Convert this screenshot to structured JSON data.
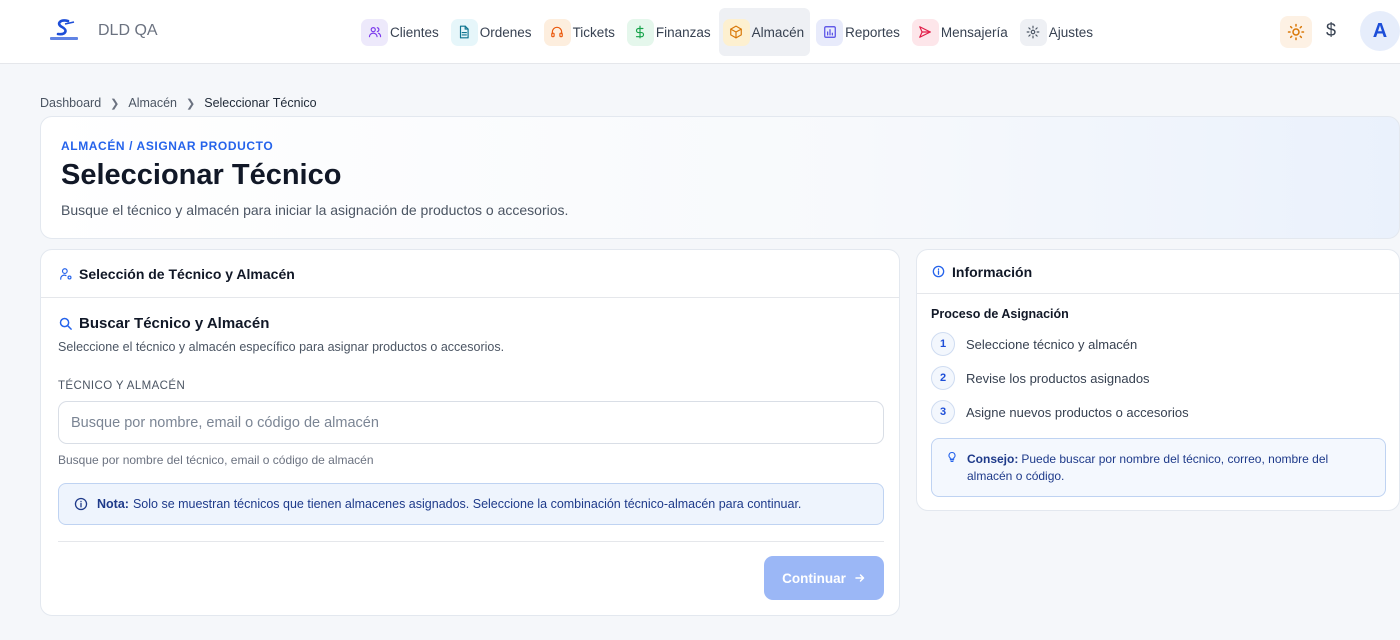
{
  "app": {
    "title": "DLD QA"
  },
  "nav": [
    {
      "label": "Clientes",
      "icon": "users-icon",
      "bg": "#ede9fb",
      "fg": "#7c3aed",
      "active": false
    },
    {
      "label": "Ordenes",
      "icon": "document-icon",
      "bg": "#e6f6fa",
      "fg": "#0e7490",
      "active": false
    },
    {
      "label": "Tickets",
      "icon": "headset-icon",
      "bg": "#fdeede",
      "fg": "#ea580c",
      "active": false
    },
    {
      "label": "Finanzas",
      "icon": "dollar-icon",
      "bg": "#e5f7ec",
      "fg": "#16a34a",
      "active": false
    },
    {
      "label": "Almacén",
      "icon": "box-icon",
      "bg": "#fdf0d0",
      "fg": "#d97706",
      "active": true
    },
    {
      "label": "Reportes",
      "icon": "chart-icon",
      "bg": "#e8ebfb",
      "fg": "#4f46e5",
      "active": false
    },
    {
      "label": "Mensajería",
      "icon": "send-icon",
      "bg": "#fde6ea",
      "fg": "#e11d48",
      "active": false
    },
    {
      "label": "Ajustes",
      "icon": "gear-icon",
      "bg": "#eef0f4",
      "fg": "#4b5563",
      "active": false
    }
  ],
  "topbar": {
    "currency_symbol": "$",
    "avatar_letter": "A"
  },
  "breadcrumb": [
    "Dashboard",
    "Almacén",
    "Seleccionar Técnico"
  ],
  "header": {
    "kicker": "ALMACÉN / ASIGNAR PRODUCTO",
    "title": "Seleccionar Técnico",
    "subtitle": "Busque el técnico y almacén para iniciar la asignación de productos o accesorios."
  },
  "main": {
    "card_title": "Selección de Técnico y Almacén",
    "section_title": "Buscar Técnico y Almacén",
    "section_desc": "Seleccione el técnico y almacén específico para asignar productos o accesorios.",
    "field_label": "TÉCNICO Y ALMACÉN",
    "search_placeholder": "Busque por nombre, email o código de almacén",
    "search_value": "",
    "field_help": "Busque por nombre del técnico, email o código de almacén",
    "note_label": "Nota:",
    "note_text": "Solo se muestran técnicos que tienen almacenes asignados. Seleccione la combinación técnico-almacén para continuar.",
    "continue_label": "Continuar"
  },
  "info": {
    "title": "Información",
    "process_title": "Proceso de Asignación",
    "steps": [
      {
        "num": "1",
        "text": "Seleccione técnico y almacén"
      },
      {
        "num": "2",
        "text": "Revise los productos asignados"
      },
      {
        "num": "3",
        "text": "Asigne nuevos productos o accesorios"
      }
    ],
    "tip_label": "Consejo:",
    "tip_text": "Puede buscar por nombre del técnico, correo, nombre del almacén o código."
  }
}
